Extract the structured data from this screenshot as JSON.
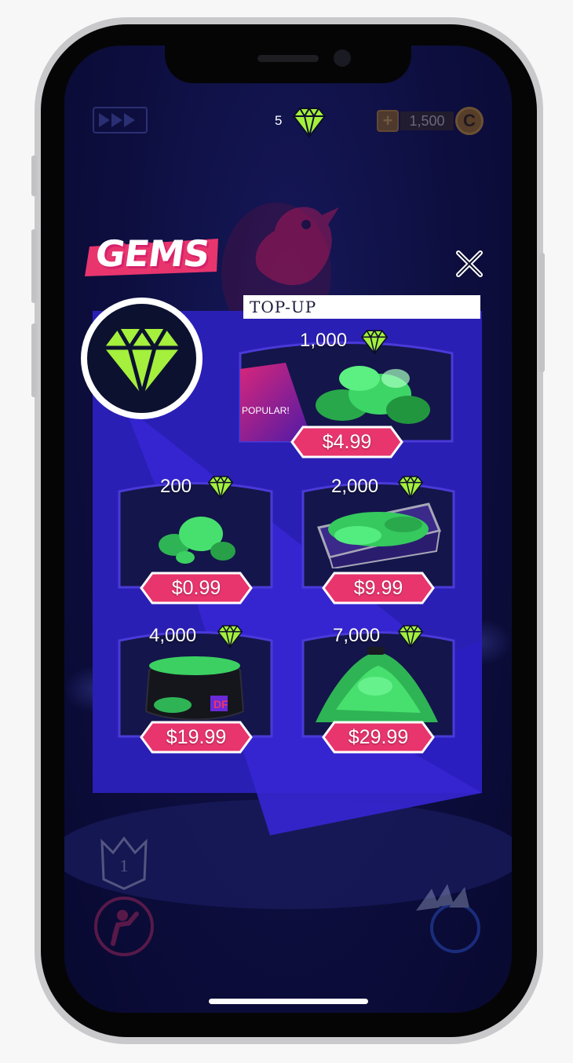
{
  "header": {
    "gem_count": "5",
    "coin_balance": "1,500",
    "coin_icon_letter": "C",
    "rank_number": "1"
  },
  "modal": {
    "title": "GEMS",
    "tab_label": "TOP-UP",
    "packs": [
      {
        "amount": "1,000",
        "price": "$4.99",
        "badge": "POPULAR!"
      },
      {
        "amount": "200",
        "price": "$0.99"
      },
      {
        "amount": "2,000",
        "price": "$9.99"
      },
      {
        "amount": "4,000",
        "price": "$19.99"
      },
      {
        "amount": "7,000",
        "price": "$29.99"
      }
    ]
  },
  "colors": {
    "accent_pink": "#e8356e",
    "gem_green": "#a4f03c",
    "panel_blue": "#3322c8",
    "card_navy": "#14154a"
  }
}
